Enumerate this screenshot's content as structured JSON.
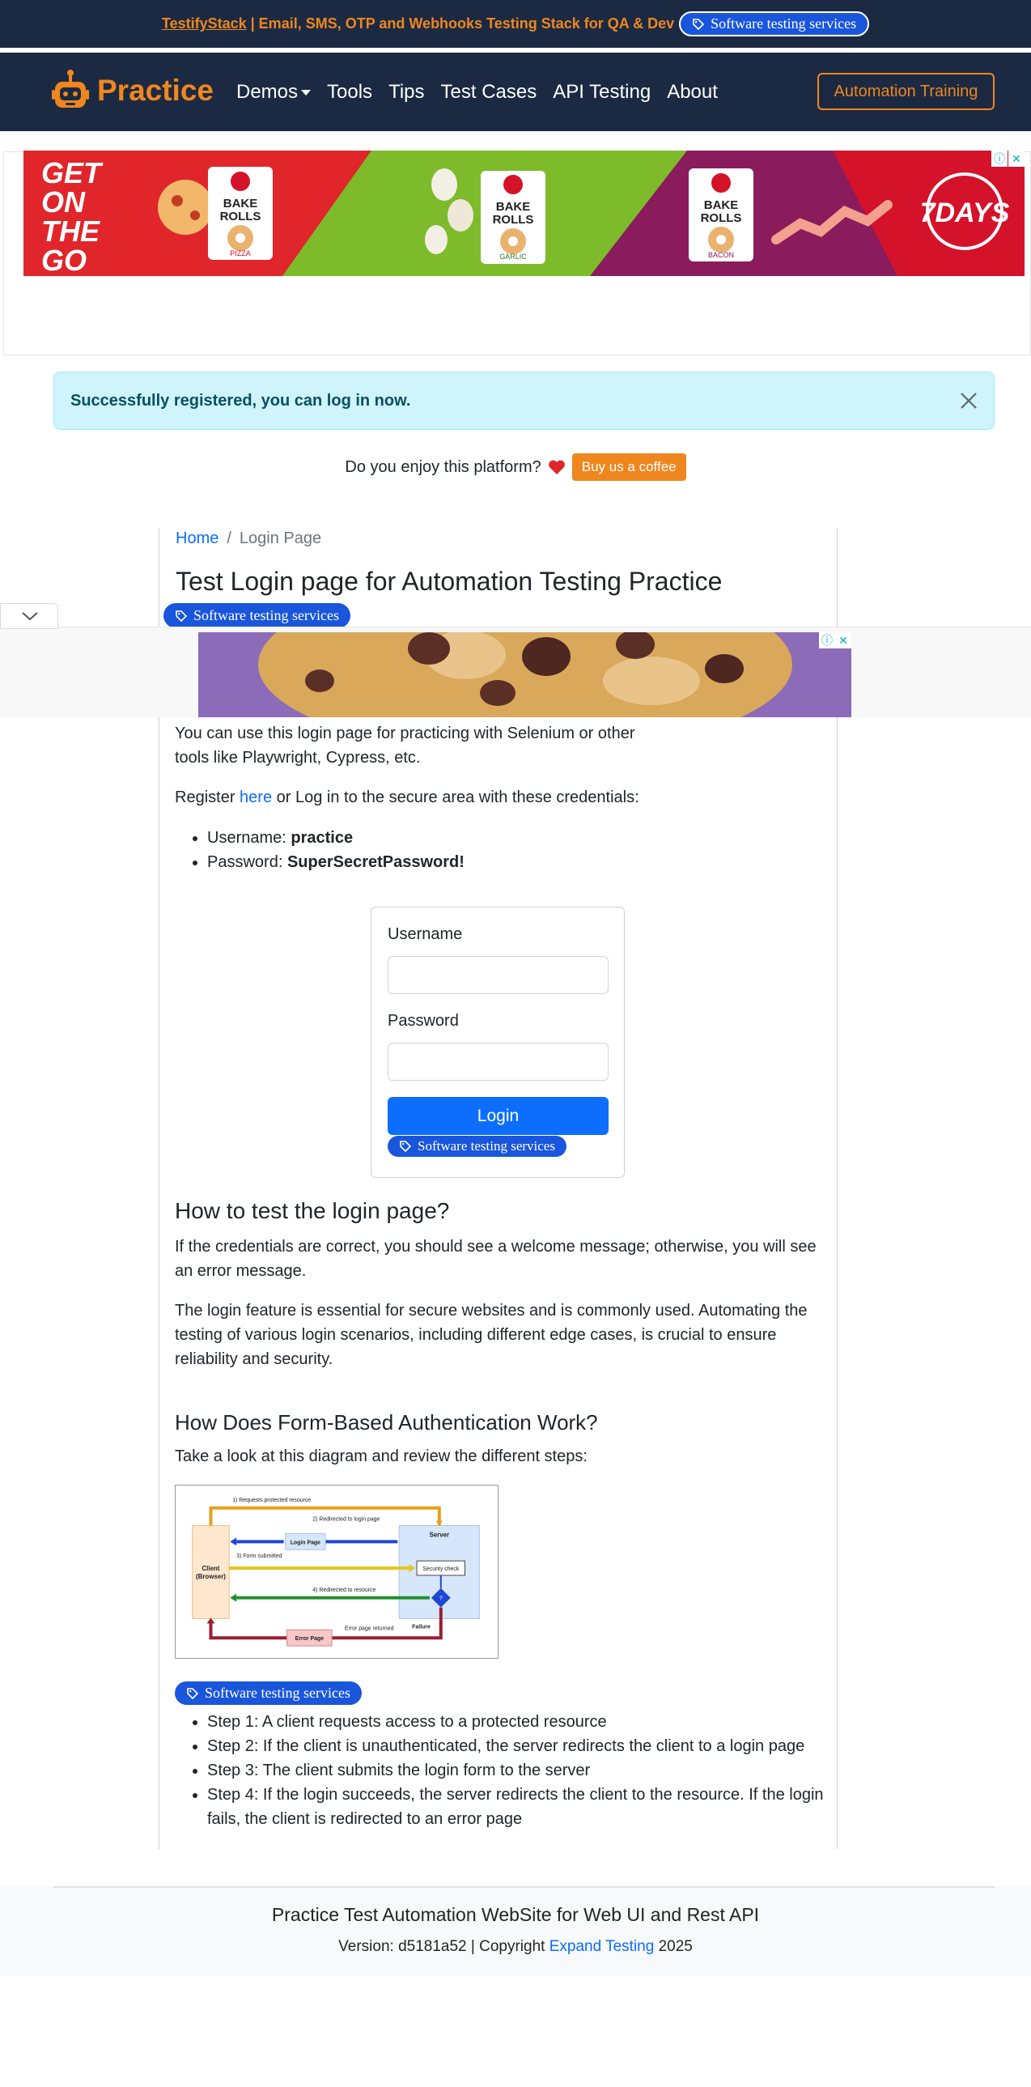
{
  "topbar": {
    "brand_link": "TestifyStack",
    "promo_text": " | Email, SMS, OTP and Webhooks Testing Stack for QA & Dev",
    "badge": "Software testing services"
  },
  "nav": {
    "brand": "Practice",
    "links": [
      "Demos",
      "Tools",
      "Tips",
      "Test Cases",
      "API Testing",
      "About"
    ],
    "cta": "Automation Training"
  },
  "ad_banner": {
    "slogan": [
      "GET",
      "ON",
      "THE",
      "GO"
    ],
    "product": [
      "BAKE",
      "ROLLS"
    ],
    "flavors": [
      "PIZZA",
      "GARLIC",
      "BACON"
    ],
    "brand_logo": "7DAYS"
  },
  "alert": {
    "message": "Successfully registered, you can log in now."
  },
  "coffee": {
    "question": "Do you enjoy this platform?",
    "button": "Buy us a coffee"
  },
  "breadcrumb": {
    "home": "Home",
    "separator": "/",
    "current": "Login Page"
  },
  "page": {
    "title": "Test Login page for Automation Testing Practice",
    "badge": "Software testing services",
    "intro_line1": "You can use this login page for practicing with Selenium or other",
    "intro_line2": "tools like Playwright, Cypress, etc.",
    "register_prefix": "Register ",
    "register_link": "here",
    "register_suffix": " or Log in to the secure area with these credentials:",
    "username_label": "Username: ",
    "username_value": "practice",
    "password_label": "Password: ",
    "password_value": "SuperSecretPassword!"
  },
  "form": {
    "username_label": "Username",
    "username_value": "",
    "password_label": "Password",
    "password_value": "",
    "login_button": "Login",
    "badge": "Software testing services"
  },
  "howto": {
    "heading": "How to test the login page?",
    "p1_line1": "If the credentials are correct, you should see a welcome message; otherwise, you will see",
    "p1_line2": "an error message.",
    "p2_line1": "The login feature is essential for secure websites and is commonly used. Automating the",
    "p2_line2": "testing of various login scenarios, including different edge cases, is crucial to ensure",
    "p2_line3": "reliability and security."
  },
  "auth": {
    "heading": "How Does Form-Based Authentication Work?",
    "intro": "Take a look at this diagram and review the different steps:",
    "badge": "Software testing services",
    "steps": [
      "Step 1: A client requests access to a protected resource",
      "Step 2: If the client is unauthenticated, the server redirects the client to a login page",
      "Step 3: The client submits the login form to the server",
      "Step 4: If the login succeeds, the server redirects the client to the resource. If the login",
      "fails, the client is redirected to an error page"
    ]
  },
  "diagram": {
    "labels": {
      "req": "1) Requests protected resource",
      "redirect_login": "2) Redirected to login page",
      "form_submitted": "3) Form submitted",
      "redirect_resource": "4) Redirected to resource",
      "error_returned": "Error page returned",
      "client": "Client",
      "client_sub": "(Browser)",
      "server": "Server",
      "login_page": "Login Page",
      "security_check": "Security check",
      "decision": "?",
      "failure": "Failure",
      "error_page": "Error Page"
    }
  },
  "footer": {
    "title": "Practice Test Automation WebSite for Web UI and Rest API",
    "version_prefix": "Version: d5181a52 | Copyright ",
    "company": "Expand Testing",
    "year": " 2025"
  },
  "colors": {
    "navy": "#1b2a42",
    "orange": "#f0861e",
    "primary": "#0d6efd",
    "badge_blue": "#1a56db",
    "alert_bg": "#cff4fc",
    "alert_text": "#055160"
  }
}
